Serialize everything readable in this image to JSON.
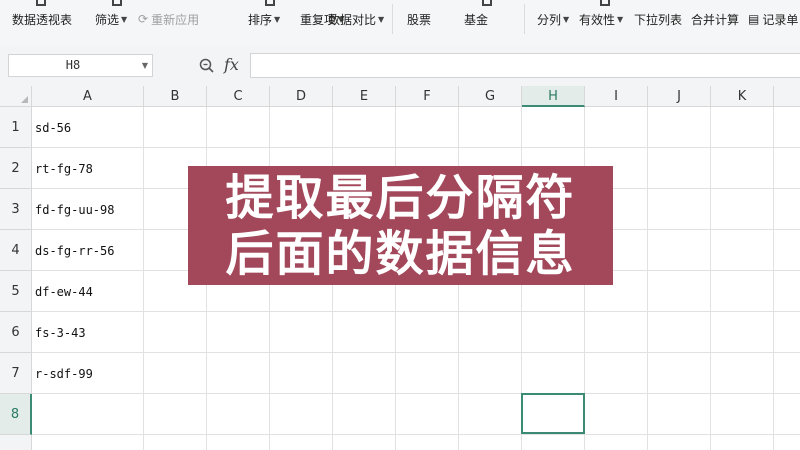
{
  "ribbon": {
    "items": [
      {
        "label": "数据透视表",
        "dropdown": false,
        "disabled": false
      },
      {
        "label": "筛选",
        "dropdown": true,
        "disabled": false
      },
      {
        "label": "重新应用",
        "dropdown": false,
        "disabled": true
      },
      {
        "label": "排序",
        "dropdown": true,
        "disabled": false
      },
      {
        "label": "重复项",
        "dropdown": true,
        "disabled": false
      },
      {
        "label": "数据对比",
        "dropdown": true,
        "disabled": false
      },
      {
        "label": "股票",
        "dropdown": false,
        "disabled": false
      },
      {
        "label": "基金",
        "dropdown": false,
        "disabled": false
      },
      {
        "label": "分列",
        "dropdown": true,
        "disabled": false
      },
      {
        "label": "有效性",
        "dropdown": true,
        "disabled": false
      },
      {
        "label": "下拉列表",
        "dropdown": false,
        "disabled": false
      },
      {
        "label": "合并计算",
        "dropdown": false,
        "disabled": false
      },
      {
        "label": "记录单",
        "dropdown": false,
        "disabled": false
      }
    ]
  },
  "formula_bar": {
    "name_box": "H8",
    "fx_label": "fx",
    "formula": ""
  },
  "sheet": {
    "columns": [
      "A",
      "B",
      "C",
      "D",
      "E",
      "F",
      "G",
      "H",
      "I",
      "J",
      "K"
    ],
    "rows": [
      "1",
      "2",
      "3",
      "4",
      "5",
      "6",
      "7",
      "8"
    ],
    "selected_column": "H",
    "selected_row": "8",
    "column_a_values": [
      "sd-56",
      "rt-fg-78",
      "fd-fg-uu-98",
      "ds-fg-rr-56",
      "df-ew-44",
      "fs-3-43",
      "r-sdf-99",
      ""
    ]
  },
  "overlay": {
    "line1": "提取最后分隔符",
    "line2": "后面的数据信息"
  },
  "colors": {
    "banner": "#a2485a",
    "selection": "#3a8a74"
  }
}
